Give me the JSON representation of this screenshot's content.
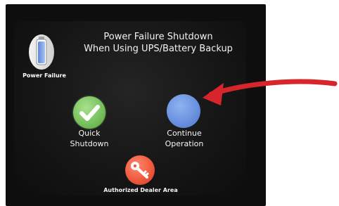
{
  "header": {
    "line1": "Power Failure Shutdown",
    "line2": "When Using UPS/Battery Backup"
  },
  "status_icon": {
    "icon": "battery-icon",
    "label": "Power Failure"
  },
  "buttons": {
    "quick_shutdown": {
      "icon": "checkmark-icon",
      "line1": "Quick",
      "line2": "Shutdown"
    },
    "continue_operation": {
      "line1": "Continue",
      "line2": "Operation"
    },
    "authorized_dealer": {
      "icon": "key-icon",
      "label": "Authorized Dealer Area"
    }
  },
  "annotation": {
    "type": "red-arrow",
    "color": "#d7262b",
    "points_to": "continue-operation-button"
  },
  "colors": {
    "screen_bg": "#151515",
    "text": "#f2f2f2",
    "quick_shutdown_green": "#79c25f",
    "continue_blue": "#6b92e0",
    "dealer_red": "#ef5a3e"
  }
}
